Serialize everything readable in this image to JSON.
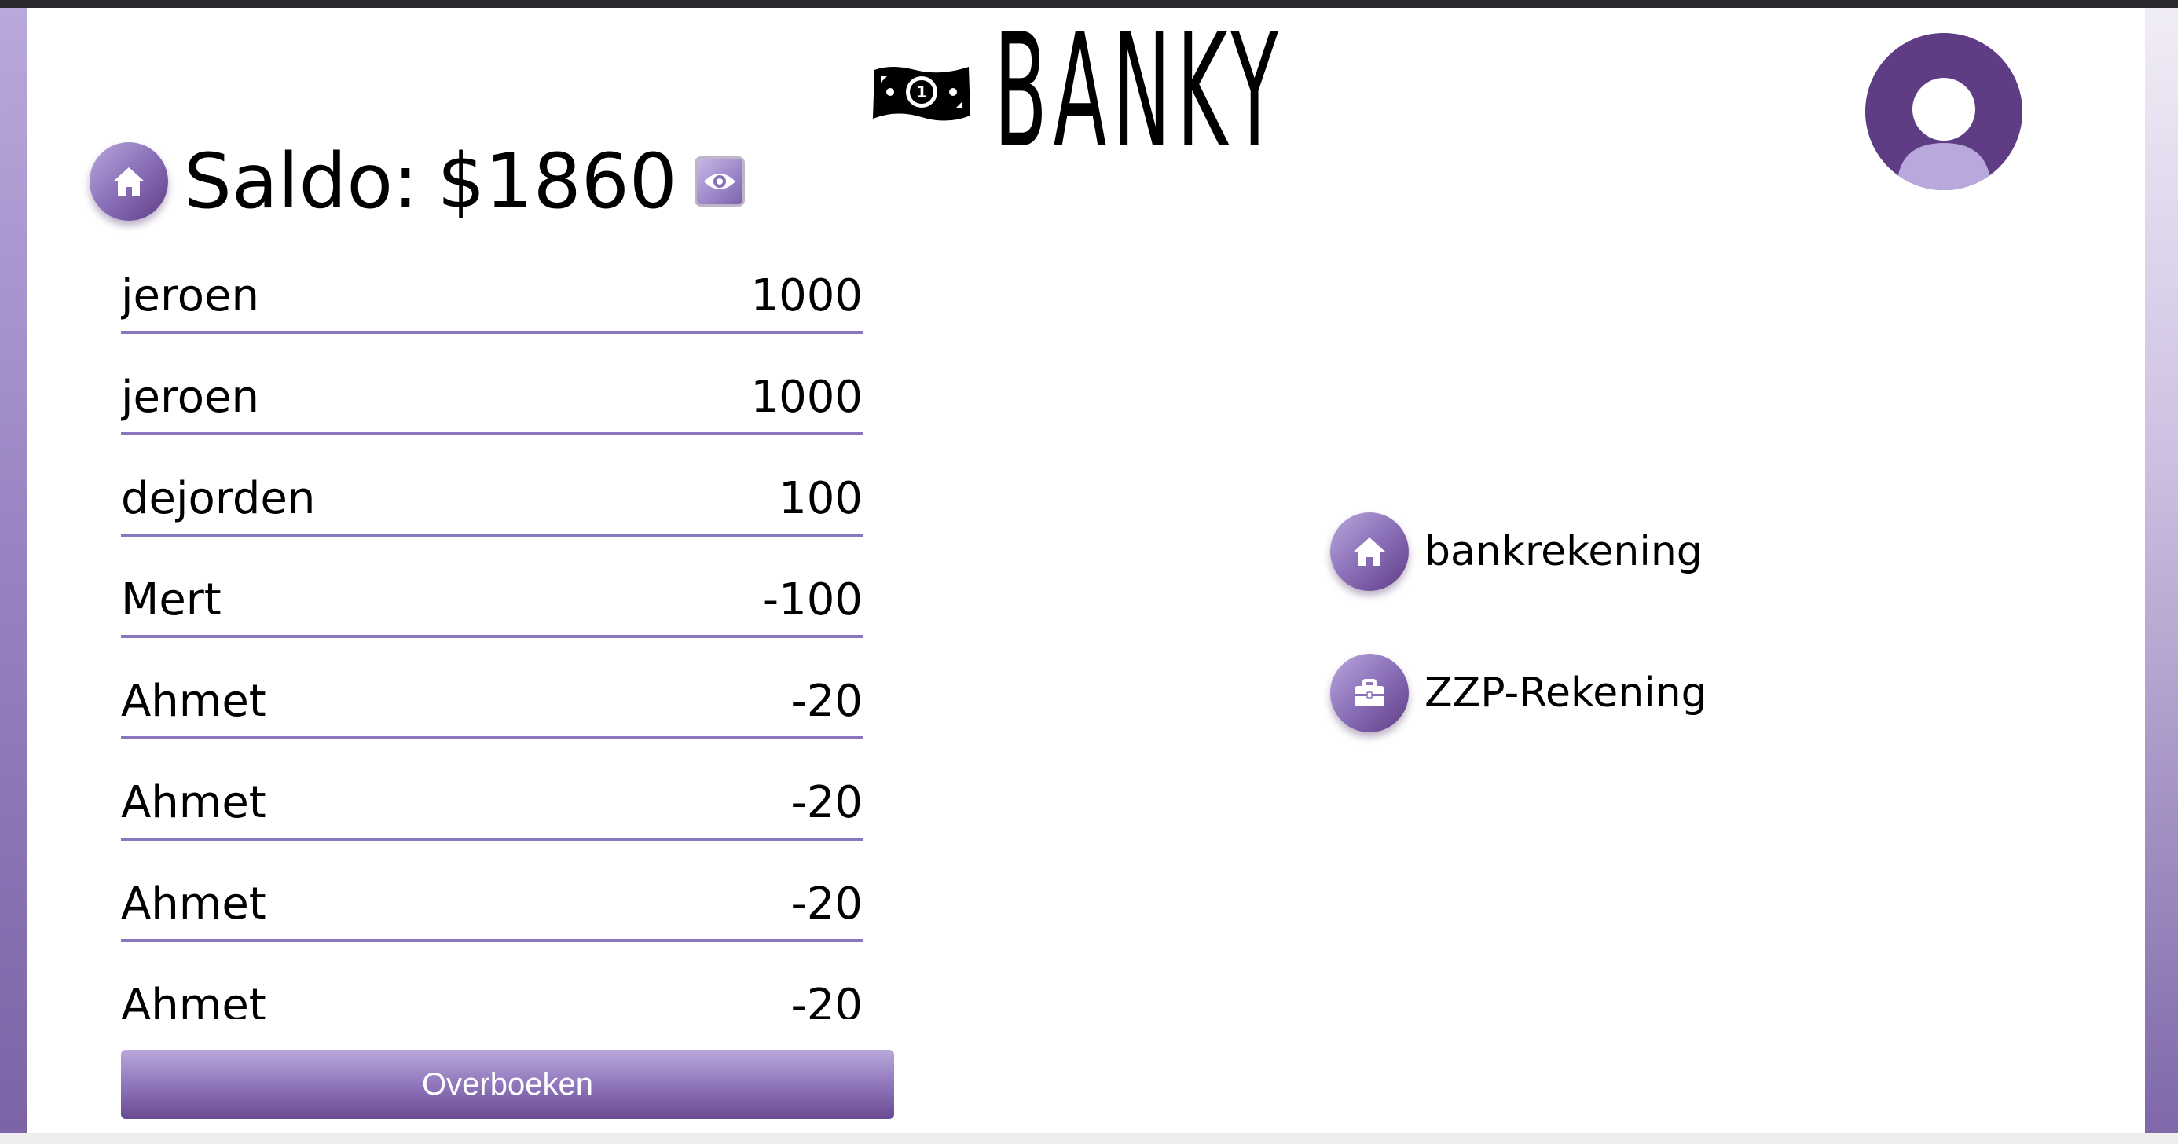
{
  "app": {
    "logo_text": "BANKY",
    "logo_note_digit": "1"
  },
  "balance": {
    "label": "Saldo:",
    "value": "$1860"
  },
  "transactions": [
    {
      "name": "jeroen",
      "amount": "1000"
    },
    {
      "name": "jeroen",
      "amount": "1000"
    },
    {
      "name": "dejorden",
      "amount": "100"
    },
    {
      "name": "Mert",
      "amount": "-100"
    },
    {
      "name": "Ahmet",
      "amount": "-20"
    },
    {
      "name": "Ahmet",
      "amount": "-20"
    },
    {
      "name": "Ahmet",
      "amount": "-20"
    },
    {
      "name": "Ahmet",
      "amount": "-20"
    }
  ],
  "actions": {
    "transfer_label": "Overboeken"
  },
  "accounts": [
    {
      "label": "bankrekening",
      "icon": "home-icon"
    },
    {
      "label": "ZZP-Rekening",
      "icon": "briefcase-icon"
    }
  ],
  "colors": {
    "accent_dark": "#5f3d85",
    "accent_light": "#b9a8dc",
    "divider": "#8a78bf"
  }
}
